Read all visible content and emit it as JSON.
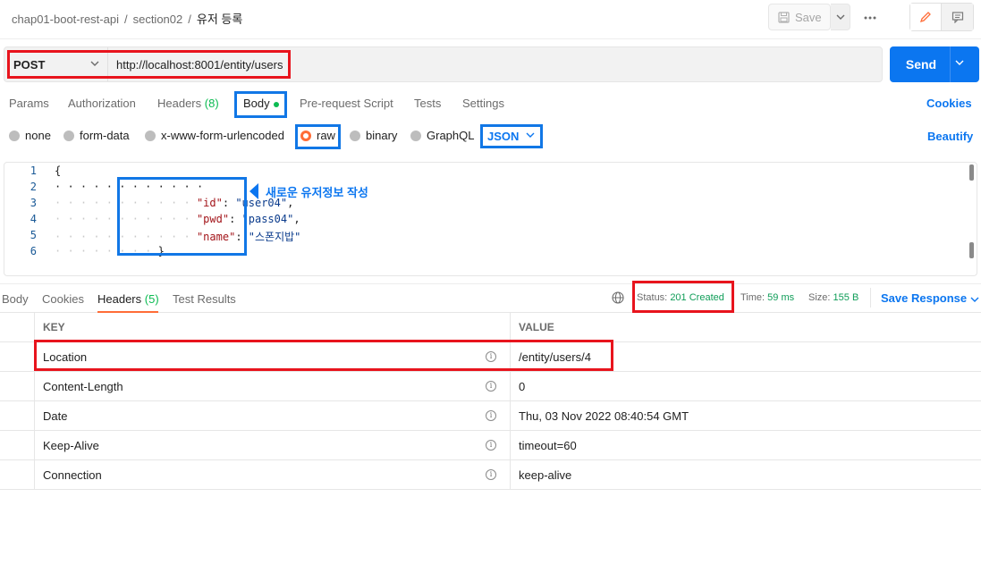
{
  "breadcrumb": {
    "collection": "chap01-boot-rest-api",
    "folder": "section02",
    "request": "유저 등록",
    "separator": "/"
  },
  "toolbar": {
    "save_label": "Save",
    "more_icon": "more-horizontal-icon",
    "edit_icon": "pencil-icon",
    "comment_icon": "comment-icon"
  },
  "request": {
    "method": "POST",
    "url": "http://localhost:8001/entity/users",
    "send_label": "Send"
  },
  "request_tabs": [
    {
      "label": "Params"
    },
    {
      "label": "Authorization"
    },
    {
      "label": "Headers",
      "count": "(8)"
    },
    {
      "label": "Body",
      "active": true
    },
    {
      "label": "Pre-request Script"
    },
    {
      "label": "Tests"
    },
    {
      "label": "Settings"
    }
  ],
  "cookies_label": "Cookies",
  "body_types": [
    {
      "label": "none"
    },
    {
      "label": "form-data"
    },
    {
      "label": "x-www-form-urlencoded"
    },
    {
      "label": "raw",
      "selected": true
    },
    {
      "label": "binary"
    },
    {
      "label": "GraphQL"
    }
  ],
  "body_format": "JSON",
  "beautify_label": "Beautify",
  "editor": {
    "line_numbers": [
      "1",
      "2",
      "3",
      "4",
      "5",
      "6"
    ],
    "open_brace": "{",
    "close_brace": "}",
    "id_key": "\"id\"",
    "id_value": "\"user04\"",
    "pwd_key": "\"pwd\"",
    "pwd_value": "\"pass04\"",
    "name_key": "\"name\"",
    "name_value": "\"스폰지밥\""
  },
  "annotation": "새로운 유저정보 작성",
  "response_tabs": [
    {
      "label": "Body"
    },
    {
      "label": "Cookies"
    },
    {
      "label": "Headers",
      "count": "(5)",
      "active": true
    },
    {
      "label": "Test Results"
    }
  ],
  "response_meta": {
    "status_label": "Status:",
    "status_value": "201 Created",
    "time_label": "Time:",
    "time_value": "59 ms",
    "size_label": "Size:",
    "size_value": "155 B",
    "save_response": "Save Response"
  },
  "headers_table": {
    "columns": [
      "KEY",
      "VALUE"
    ],
    "rows": [
      {
        "key": "Location",
        "value": "/entity/users/4"
      },
      {
        "key": "Content-Length",
        "value": "0"
      },
      {
        "key": "Date",
        "value": "Thu, 03 Nov 2022 08:40:54 GMT"
      },
      {
        "key": "Keep-Alive",
        "value": "timeout=60"
      },
      {
        "key": "Connection",
        "value": "keep-alive"
      }
    ]
  },
  "colors": {
    "accent_blue": "#0b76f0",
    "highlight_red": "#e8141d",
    "highlight_blue": "#1177e6",
    "status_green": "#0f9d58",
    "tab_orange": "#ff6c37"
  }
}
